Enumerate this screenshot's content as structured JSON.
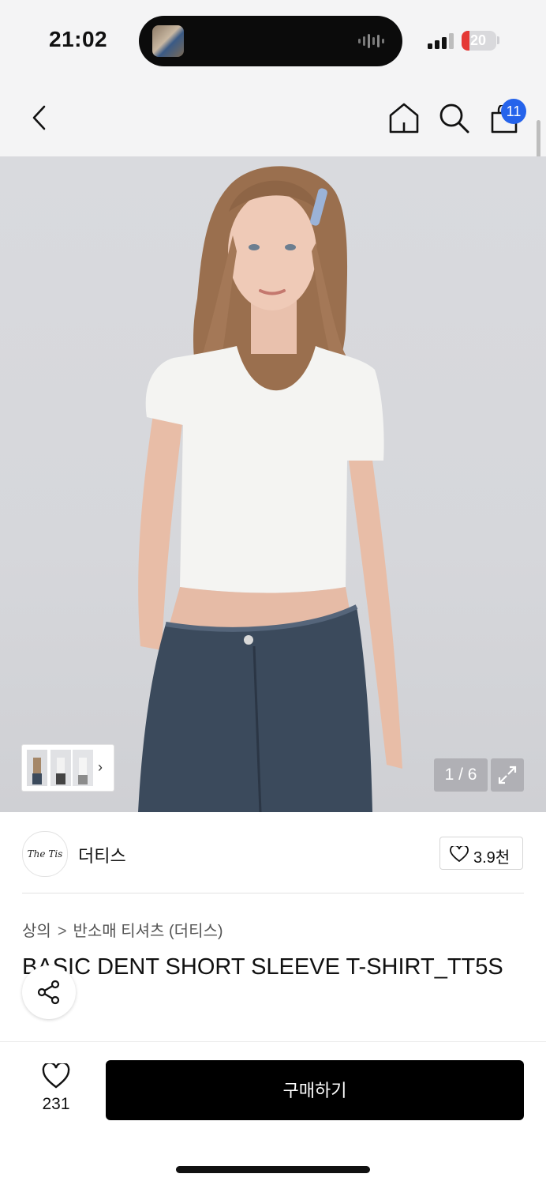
{
  "status_bar": {
    "time": "21:02",
    "battery": "20"
  },
  "nav": {
    "cart_count": "11",
    "icons": [
      "back-chevron-icon",
      "home-icon",
      "search-icon",
      "shopping-bag-icon"
    ]
  },
  "gallery": {
    "pager": "1 / 6",
    "chevron": "›"
  },
  "brand": {
    "logo_text": "The Tis",
    "name": "더티스",
    "likes": "3.9천"
  },
  "breadcrumb": {
    "category": "상의",
    "separator": ">",
    "subcategory": "반소매 티셔츠 (더티스)"
  },
  "product": {
    "title": "BASIC DENT SHORT SLEEVE T-SHIRT_TT5S"
  },
  "bottom_bar": {
    "wish_count": "231",
    "buy_label": "구매하기"
  },
  "colors": {
    "accent_blue": "#2563eb",
    "buy_button": "#000000",
    "nav_bg": "#f4f4f5"
  }
}
